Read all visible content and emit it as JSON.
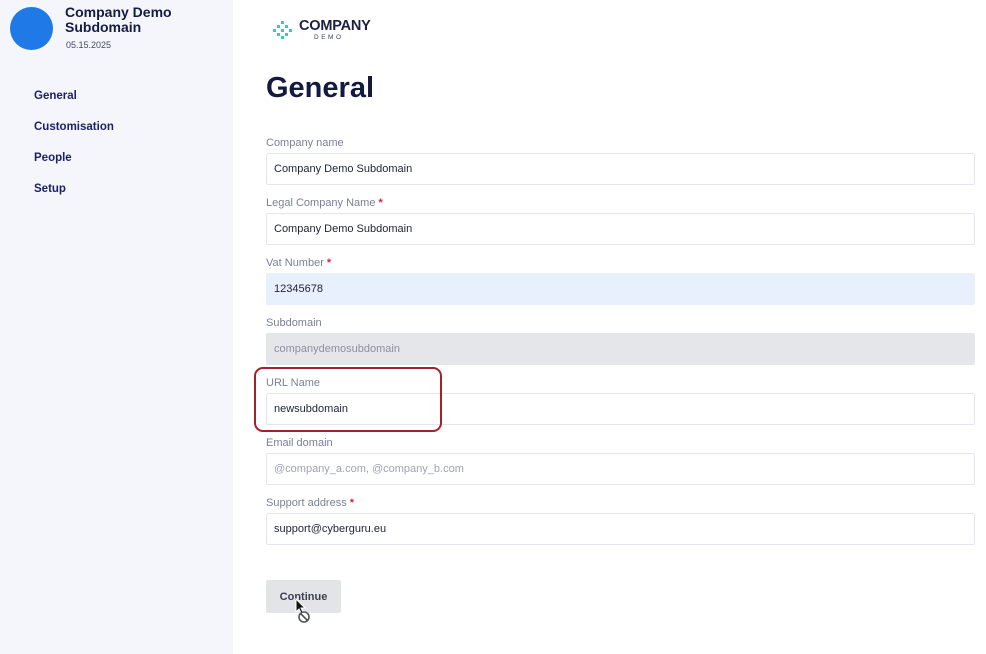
{
  "org": {
    "name": "Company Demo Subdomain",
    "date": "05.15.2025"
  },
  "nav": {
    "items": [
      {
        "label": "General"
      },
      {
        "label": "Customisation"
      },
      {
        "label": "People"
      },
      {
        "label": "Setup"
      }
    ]
  },
  "logo": {
    "word": "COMPANY",
    "sub": "DEMO"
  },
  "page": {
    "title": "General"
  },
  "form": {
    "company_name": {
      "label": "Company name",
      "value": "Company Demo Subdomain"
    },
    "legal_name": {
      "label": "Legal Company Name",
      "required": "*",
      "value": "Company Demo Subdomain"
    },
    "vat_number": {
      "label": "Vat Number",
      "required": "*",
      "value": "12345678"
    },
    "subdomain": {
      "label": "Subdomain",
      "value": "companydemosubdomain"
    },
    "url_name": {
      "label": "URL Name",
      "value": "newsubdomain"
    },
    "email_domain": {
      "label": "Email domain",
      "placeholder": "@company_a.com, @company_b.com"
    },
    "support_address": {
      "label": "Support address",
      "required": "*",
      "value": "support@cyberguru.eu"
    }
  },
  "actions": {
    "continue_label": "Continue"
  },
  "colors": {
    "accent": "#1f7ae8",
    "nav_text": "#1e2264",
    "required": "#d4283f",
    "highlight": "#a3202c",
    "logo_mark": "#3ec9a7"
  }
}
